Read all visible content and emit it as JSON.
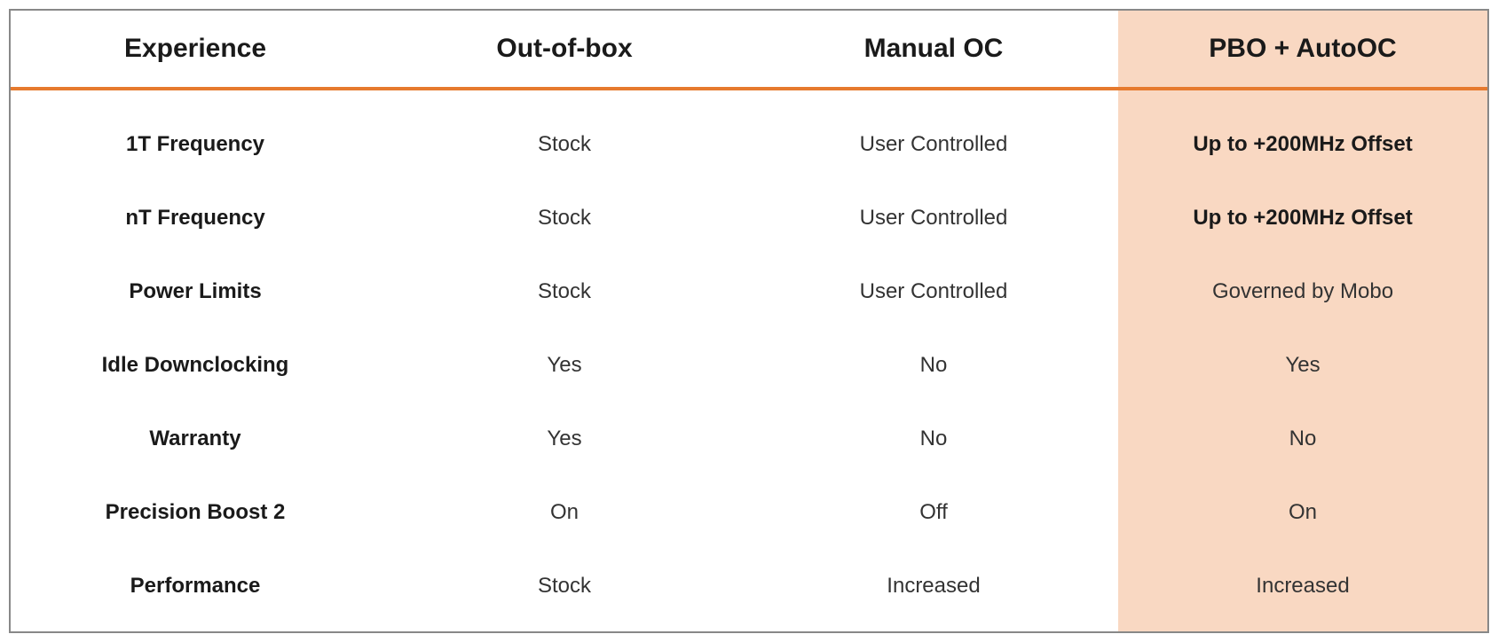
{
  "table": {
    "headers": [
      "Experience",
      "Out-of-box",
      "Manual OC",
      "PBO + AutoOC"
    ],
    "rows": [
      {
        "label": "1T Frequency",
        "cells": [
          "Stock",
          "User Controlled",
          "Up to +200MHz Offset"
        ],
        "bold_last": true
      },
      {
        "label": "nT Frequency",
        "cells": [
          "Stock",
          "User Controlled",
          "Up to +200MHz Offset"
        ],
        "bold_last": true
      },
      {
        "label": "Power Limits",
        "cells": [
          "Stock",
          "User Controlled",
          "Governed by Mobo"
        ],
        "bold_last": false
      },
      {
        "label": "Idle Downclocking",
        "cells": [
          "Yes",
          "No",
          "Yes"
        ],
        "bold_last": false
      },
      {
        "label": "Warranty",
        "cells": [
          "Yes",
          "No",
          "No"
        ],
        "bold_last": false
      },
      {
        "label": "Precision Boost 2",
        "cells": [
          "On",
          "Off",
          "On"
        ],
        "bold_last": false
      },
      {
        "label": "Performance",
        "cells": [
          "Stock",
          "Increased",
          "Increased"
        ],
        "bold_last": false
      }
    ],
    "colors": {
      "highlight_bg": "#f9d8c2",
      "accent": "#e67a2e",
      "border": "#888"
    }
  }
}
